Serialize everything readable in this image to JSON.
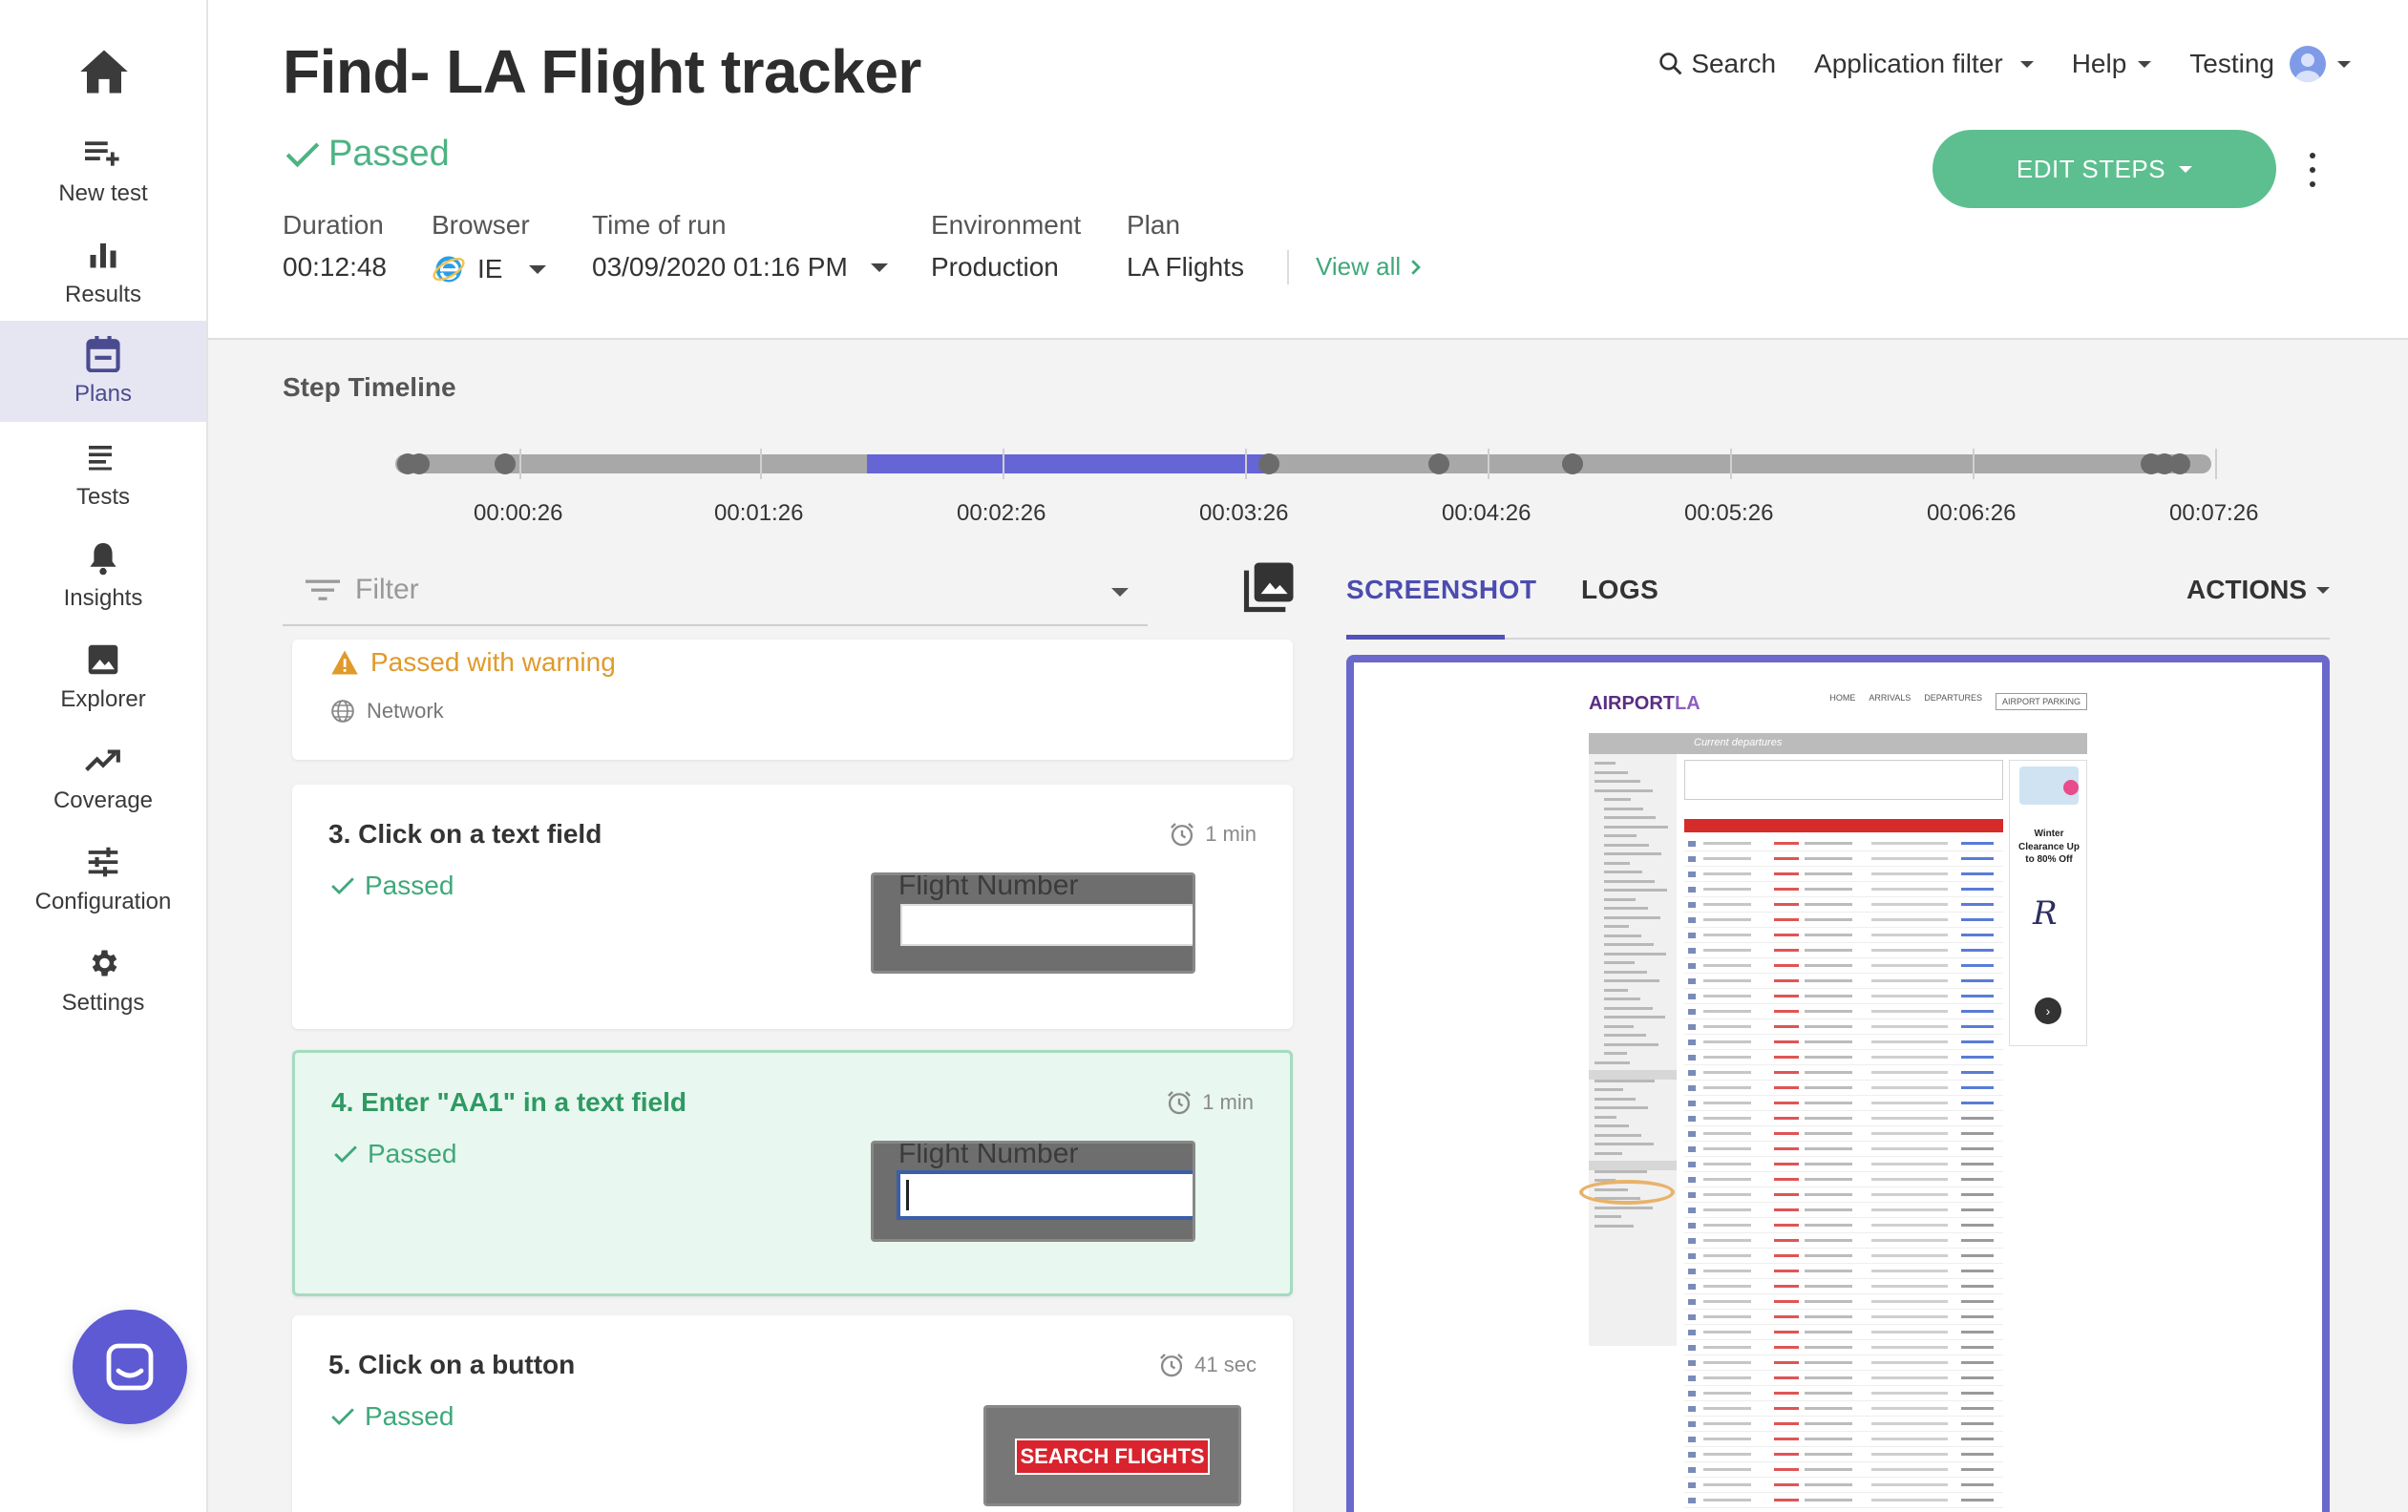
{
  "sidebar": {
    "items": [
      {
        "label": "New test",
        "icon": "playlist-add-icon"
      },
      {
        "label": "Results",
        "icon": "bar-chart-icon"
      },
      {
        "label": "Plans",
        "icon": "calendar-icon",
        "active": true
      },
      {
        "label": "Tests",
        "icon": "list-icon"
      },
      {
        "label": "Insights",
        "icon": "bell-icon"
      },
      {
        "label": "Explorer",
        "icon": "image-icon"
      },
      {
        "label": "Coverage",
        "icon": "trending-up-icon"
      },
      {
        "label": "Configuration",
        "icon": "sliders-icon"
      },
      {
        "label": "Settings",
        "icon": "gear-icon"
      }
    ]
  },
  "header": {
    "title": "Find- LA Flight tracker",
    "status": "Passed",
    "duration_label": "Duration",
    "duration": "00:12:48",
    "browser_label": "Browser",
    "browser": "IE",
    "time_label": "Time of run",
    "time": "03/09/2020 01:16 PM",
    "environment_label": "Environment",
    "environment": "Production",
    "plan_label": "Plan",
    "plan": "LA Flights",
    "view_all": "View all"
  },
  "topnav": {
    "search": "Search",
    "app_filter": "Application filter",
    "help": "Help",
    "user": "Testing"
  },
  "edit_steps": "EDIT STEPS",
  "timeline": {
    "title": "Step Timeline",
    "labels": [
      "00:00:26",
      "00:01:26",
      "00:02:26",
      "00:03:26",
      "00:04:26",
      "00:05:26",
      "00:06:26",
      "00:07:26"
    ]
  },
  "filter": {
    "placeholder": "Filter"
  },
  "steps": {
    "warning_card": {
      "status": "Passed with warning",
      "type": "Network"
    },
    "s3": {
      "title": "3. Click on a text field",
      "status": "Passed",
      "duration": "1 min",
      "thumb_label": "Flight Number"
    },
    "s4": {
      "title": "4. Enter \"AA1\" in a text field",
      "status": "Passed",
      "duration": "1 min",
      "thumb_label": "Flight Number"
    },
    "s5": {
      "title": "5. Click on a button",
      "status": "Passed",
      "duration": "41 sec",
      "thumb_button": "SEARCH FLIGHTS"
    }
  },
  "panel": {
    "tab_screenshot": "SCREENSHOT",
    "tab_logs": "LOGS",
    "actions": "ACTIONS"
  },
  "site": {
    "logo_a": "AIRPORT",
    "logo_b": "LA",
    "nav": [
      "HOME",
      "ARRIVALS",
      "DEPARTURES",
      "AIRPORT PARKING"
    ],
    "bar_title": "Current departures",
    "ad_text": "Winter Clearance Up to 80% Off",
    "ad_logo": "R"
  },
  "colors": {
    "accent": "#5d5ad4",
    "success": "#4cb383",
    "warning": "#e09a2b"
  }
}
